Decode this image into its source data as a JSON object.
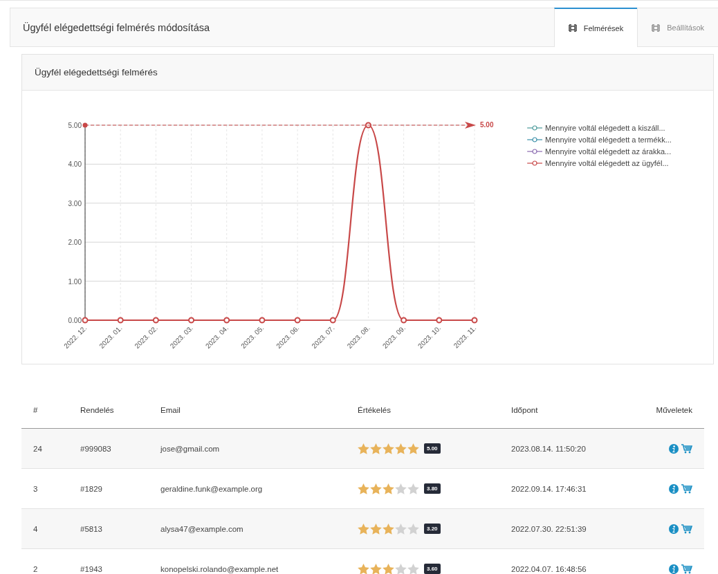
{
  "header": {
    "title": "Ügyfél elégedettségi felmérés módosítása"
  },
  "tabs": [
    {
      "label": "Felmérések",
      "selected": true
    },
    {
      "label": "Beállítások",
      "selected": false
    }
  ],
  "card": {
    "title": "Ügyfél elégedettségi felmérés",
    "chart_data": {
      "type": "line",
      "categories": [
        "2022. 12.",
        "2023. 01.",
        "2023. 02.",
        "2023. 03.",
        "2023. 04.",
        "2023. 05.",
        "2023. 06.",
        "2023. 07.",
        "2023. 08.",
        "2023. 09.",
        "2023. 10.",
        "2023. 11."
      ],
      "ylim": [
        0,
        5
      ],
      "yticks": [
        {
          "value": 0,
          "label": "0.00"
        },
        {
          "value": 1,
          "label": "1.00"
        },
        {
          "value": 2,
          "label": "2.00"
        },
        {
          "value": 3,
          "label": "3.00"
        },
        {
          "value": 4,
          "label": "4.00"
        },
        {
          "value": 5,
          "label": "5.00"
        }
      ],
      "series": [
        {
          "name": "Mennyire voltál elégedett a kiszáll...",
          "color": "#4a9a9a",
          "values": [
            null,
            null,
            null,
            null,
            null,
            null,
            null,
            null,
            null,
            null,
            null,
            null
          ]
        },
        {
          "name": "Mennyire voltál elégedett a termékk...",
          "color": "#3a8fa8",
          "values": [
            null,
            null,
            null,
            null,
            null,
            null,
            null,
            null,
            null,
            null,
            null,
            null
          ]
        },
        {
          "name": "Mennyire voltál elégedett az árakka...",
          "color": "#8a6ab0",
          "values": [
            null,
            null,
            null,
            null,
            null,
            null,
            null,
            null,
            null,
            null,
            null,
            null
          ]
        },
        {
          "name": "Mennyire voltál elégedett az ügyfél...",
          "color": "#c84848",
          "marker": "circle",
          "values": [
            0,
            0,
            0,
            0,
            0,
            0,
            0,
            0,
            5,
            0,
            0,
            0
          ]
        }
      ],
      "grid": true,
      "ref_lines": [
        {
          "axis": "y",
          "value": 5,
          "label": "5.00",
          "color": "#c84848"
        }
      ]
    }
  },
  "table": {
    "columns": [
      "#",
      "Rendelés",
      "Email",
      "Értékelés",
      "Időpont",
      "Műveletek"
    ],
    "rows": [
      {
        "id": "24",
        "order": "#999083",
        "email": "jose@gmail.com",
        "stars": 5,
        "score": "5.00",
        "time": "2023.08.14. 11:50:20"
      },
      {
        "id": "3",
        "order": "#1829",
        "email": "geraldine.funk@example.org",
        "stars": 3,
        "score": "3.80",
        "time": "2022.09.14. 17:46:31"
      },
      {
        "id": "4",
        "order": "#5813",
        "email": "alysa47@example.com",
        "stars": 3,
        "score": "3.20",
        "time": "2022.07.30. 22:51:39"
      },
      {
        "id": "2",
        "order": "#1943",
        "email": "konopelski.rolando@example.net",
        "stars": 3,
        "score": "3.60",
        "time": "2022.04.07. 16:48:56"
      }
    ]
  }
}
